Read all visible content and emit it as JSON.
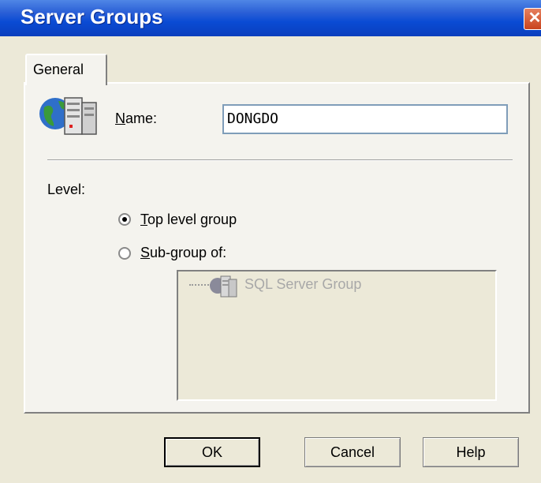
{
  "window": {
    "title": "Server Groups",
    "close_glyph": "✕"
  },
  "tabs": [
    {
      "label": "General",
      "active": true
    }
  ],
  "name_field": {
    "label_underline": "N",
    "label_rest": "ame:",
    "value": "DONGDO"
  },
  "level": {
    "label": "Level:",
    "options": [
      {
        "underline": "T",
        "rest": "op level group",
        "selected": true
      },
      {
        "underline": "S",
        "rest": "ub-group of:",
        "selected": false
      }
    ]
  },
  "tree": {
    "items": [
      {
        "label": "SQL Server Group",
        "icon": "server-group-icon",
        "disabled": true
      }
    ]
  },
  "buttons": {
    "ok": "OK",
    "cancel": "Cancel",
    "help": "Help"
  },
  "colors": {
    "title_bar": "#0a4bd4",
    "dialog_bg": "#ece9d8",
    "disabled_text": "#a8a8a8"
  }
}
